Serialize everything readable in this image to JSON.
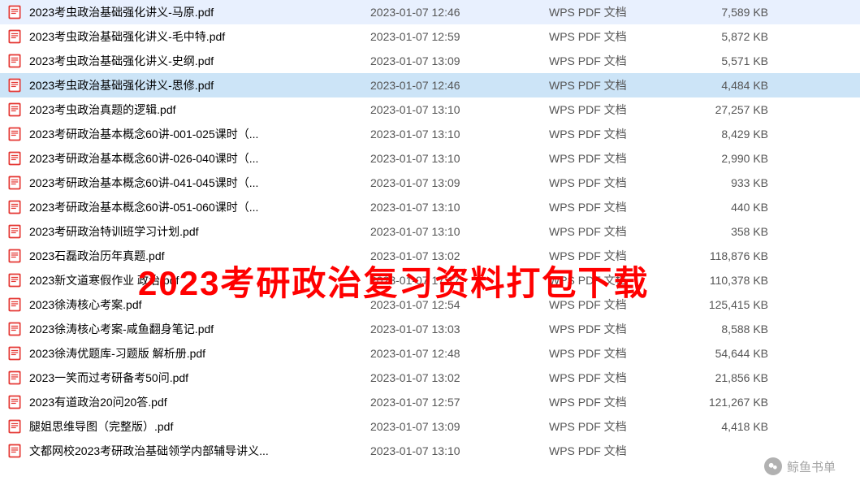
{
  "overlay": "2023考研政治复习资料打包下载",
  "watermark": "鲸鱼书单",
  "selectedIndex": 3,
  "files": [
    {
      "name": "2023考虫政治基础强化讲义-马原.pdf",
      "date": "2023-01-07 12:46",
      "type": "WPS PDF 文档",
      "size": "7,589 KB"
    },
    {
      "name": "2023考虫政治基础强化讲义-毛中特.pdf",
      "date": "2023-01-07 12:59",
      "type": "WPS PDF 文档",
      "size": "5,872 KB"
    },
    {
      "name": "2023考虫政治基础强化讲义-史纲.pdf",
      "date": "2023-01-07 13:09",
      "type": "WPS PDF 文档",
      "size": "5,571 KB"
    },
    {
      "name": "2023考虫政治基础强化讲义-思修.pdf",
      "date": "2023-01-07 12:46",
      "type": "WPS PDF 文档",
      "size": "4,484 KB"
    },
    {
      "name": "2023考虫政治真题的逻辑.pdf",
      "date": "2023-01-07 13:10",
      "type": "WPS PDF 文档",
      "size": "27,257 KB"
    },
    {
      "name": "2023考研政治基本概念60讲-001-025课时（...",
      "date": "2023-01-07 13:10",
      "type": "WPS PDF 文档",
      "size": "8,429 KB"
    },
    {
      "name": "2023考研政治基本概念60讲-026-040课时（...",
      "date": "2023-01-07 13:10",
      "type": "WPS PDF 文档",
      "size": "2,990 KB"
    },
    {
      "name": "2023考研政治基本概念60讲-041-045课时（...",
      "date": "2023-01-07 13:09",
      "type": "WPS PDF 文档",
      "size": "933 KB"
    },
    {
      "name": "2023考研政治基本概念60讲-051-060课时（...",
      "date": "2023-01-07 13:10",
      "type": "WPS PDF 文档",
      "size": "440 KB"
    },
    {
      "name": "2023考研政治特训班学习计划.pdf",
      "date": "2023-01-07 13:10",
      "type": "WPS PDF 文档",
      "size": "358 KB"
    },
    {
      "name": "2023石磊政治历年真题.pdf",
      "date": "2023-01-07 13:02",
      "type": "WPS PDF 文档",
      "size": "118,876 KB"
    },
    {
      "name": "2023新文道寒假作业 政治.pdf",
      "date": "2023-01-07 17:17",
      "type": "WPS PDF 文档",
      "size": "110,378 KB"
    },
    {
      "name": "2023徐涛核心考案.pdf",
      "date": "2023-01-07 12:54",
      "type": "WPS PDF 文档",
      "size": "125,415 KB"
    },
    {
      "name": "2023徐涛核心考案-咸鱼翻身笔记.pdf",
      "date": "2023-01-07 13:03",
      "type": "WPS PDF 文档",
      "size": "8,588 KB"
    },
    {
      "name": "2023徐涛优题库-习题版 解析册.pdf",
      "date": "2023-01-07 12:48",
      "type": "WPS PDF 文档",
      "size": "54,644 KB"
    },
    {
      "name": "2023一笑而过考研备考50问.pdf",
      "date": "2023-01-07 13:02",
      "type": "WPS PDF 文档",
      "size": "21,856 KB"
    },
    {
      "name": "2023有道政治20问20答.pdf",
      "date": "2023-01-07 12:57",
      "type": "WPS PDF 文档",
      "size": "121,267 KB"
    },
    {
      "name": "腿姐思维导图（完整版）.pdf",
      "date": "2023-01-07 13:09",
      "type": "WPS PDF 文档",
      "size": "4,418 KB"
    },
    {
      "name": "文都网校2023考研政治基础领学内部辅导讲义...",
      "date": "2023-01-07 13:10",
      "type": "WPS PDF 文档",
      "size": ""
    }
  ]
}
